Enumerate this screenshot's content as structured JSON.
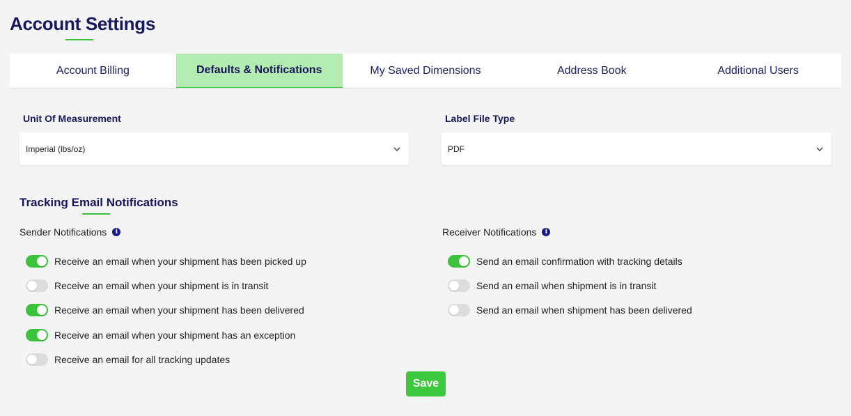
{
  "page": {
    "title": "Account Settings"
  },
  "tabs": [
    {
      "label": "Account Billing",
      "active": false
    },
    {
      "label": "Defaults & Notifications",
      "active": true
    },
    {
      "label": "My Saved Dimensions",
      "active": false
    },
    {
      "label": "Address Book",
      "active": false
    },
    {
      "label": "Additional Users",
      "active": false
    }
  ],
  "unit_of_measurement": {
    "label": "Unit Of Measurement",
    "value": "Imperial (lbs/oz)"
  },
  "label_file_type": {
    "label": "Label File Type",
    "value": "PDF"
  },
  "tracking": {
    "title": "Tracking Email Notifications",
    "sender": {
      "heading": "Sender Notifications",
      "items": [
        {
          "label": "Receive an email when your shipment has been picked up",
          "on": true
        },
        {
          "label": "Receive an email when your shipment is in transit",
          "on": false
        },
        {
          "label": "Receive an email when your shipment has been delivered",
          "on": true
        },
        {
          "label": "Receive an email when your shipment has an exception",
          "on": true
        },
        {
          "label": "Receive an email for all tracking updates",
          "on": false
        }
      ]
    },
    "receiver": {
      "heading": "Receiver Notifications",
      "items": [
        {
          "label": "Send an email confirmation with tracking details",
          "on": true
        },
        {
          "label": "Send an email when shipment is in transit",
          "on": false
        },
        {
          "label": "Send an email when shipment has been delivered",
          "on": false
        }
      ]
    }
  },
  "actions": {
    "save_label": "Save"
  },
  "colors": {
    "accent_green": "#3bc43b",
    "active_tab_bg": "#b3ecb0",
    "title_navy": "#17175c",
    "toggle_off": "#dcdcdc"
  },
  "icons": {
    "info": "info-icon",
    "chevron": "chevron-down-icon"
  }
}
